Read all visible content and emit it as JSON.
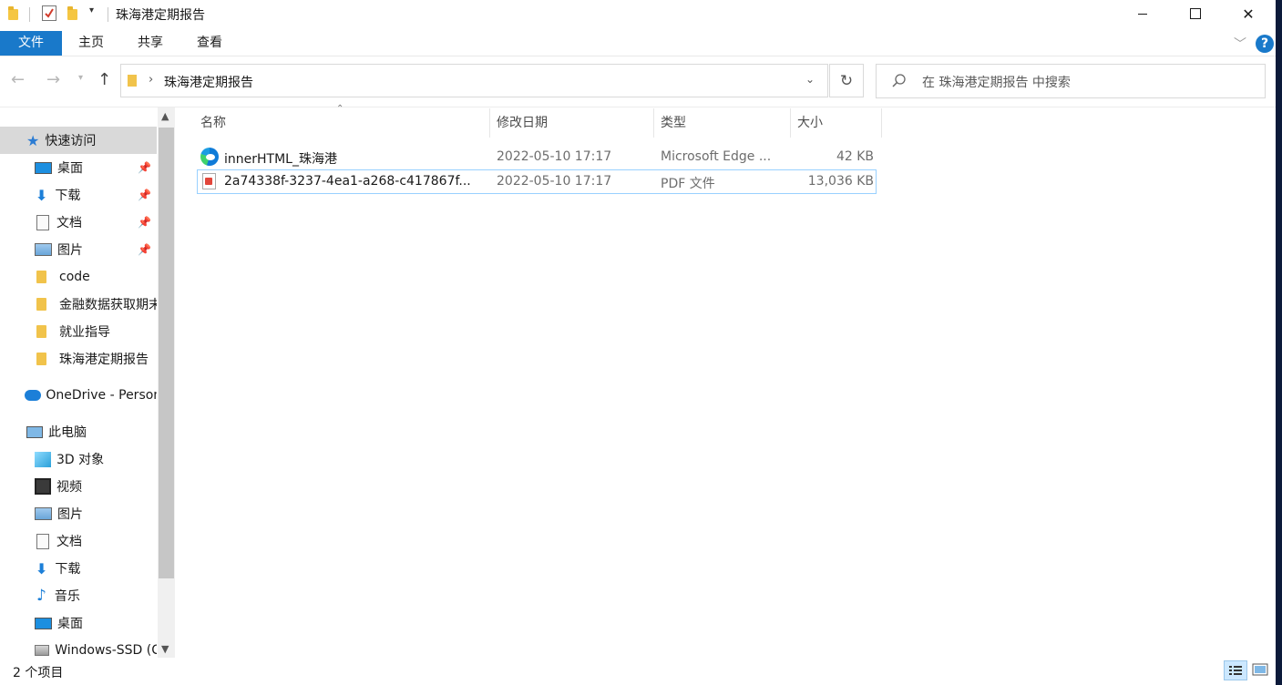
{
  "window": {
    "title": "珠海港定期报告"
  },
  "ribbon": {
    "tabs": [
      "文件",
      "主页",
      "共享",
      "查看"
    ]
  },
  "address": {
    "path": "珠海港定期报告",
    "search_placeholder": "在 珠海港定期报告 中搜索"
  },
  "sidebar": {
    "items": [
      {
        "label": "快速访问",
        "icon": "star-icon"
      },
      {
        "label": "桌面",
        "icon": "desktop-icon",
        "pinned": true
      },
      {
        "label": "下载",
        "icon": "download-icon",
        "pinned": true
      },
      {
        "label": "文档",
        "icon": "document-icon",
        "pinned": true
      },
      {
        "label": "图片",
        "icon": "pictures-icon",
        "pinned": true
      },
      {
        "label": "code",
        "icon": "folder-icon"
      },
      {
        "label": "金融数据获取期末",
        "icon": "folder-icon"
      },
      {
        "label": "就业指导",
        "icon": "folder-icon"
      },
      {
        "label": "珠海港定期报告",
        "icon": "folder-icon"
      },
      {
        "label": "OneDrive - Personal",
        "icon": "cloud-icon"
      },
      {
        "label": "此电脑",
        "icon": "computer-icon"
      },
      {
        "label": "3D 对象",
        "icon": "cube-icon"
      },
      {
        "label": "视频",
        "icon": "video-icon"
      },
      {
        "label": "图片",
        "icon": "pictures-icon"
      },
      {
        "label": "文档",
        "icon": "document-icon"
      },
      {
        "label": "下载",
        "icon": "download-icon"
      },
      {
        "label": "音乐",
        "icon": "music-icon"
      },
      {
        "label": "桌面",
        "icon": "desktop-icon"
      },
      {
        "label": "Windows-SSD (C:)",
        "icon": "drive-icon"
      }
    ]
  },
  "columns": {
    "name": "名称",
    "modified": "修改日期",
    "type": "类型",
    "size": "大小"
  },
  "files": [
    {
      "name": "innerHTML_珠海港",
      "modified": "2022-05-10 17:17",
      "type": "Microsoft Edge ...",
      "size": "42 KB",
      "icon": "edge-icon"
    },
    {
      "name": "2a74338f-3237-4ea1-a268-c417867f...",
      "modified": "2022-05-10 17:17",
      "type": "PDF 文件",
      "size": "13,036 KB",
      "icon": "pdf-icon"
    }
  ],
  "status": {
    "count": "2 个项目"
  },
  "colors": {
    "accent": "#1979ca",
    "selection_border": "#99d1ff",
    "hover": "#d9d9d9"
  }
}
